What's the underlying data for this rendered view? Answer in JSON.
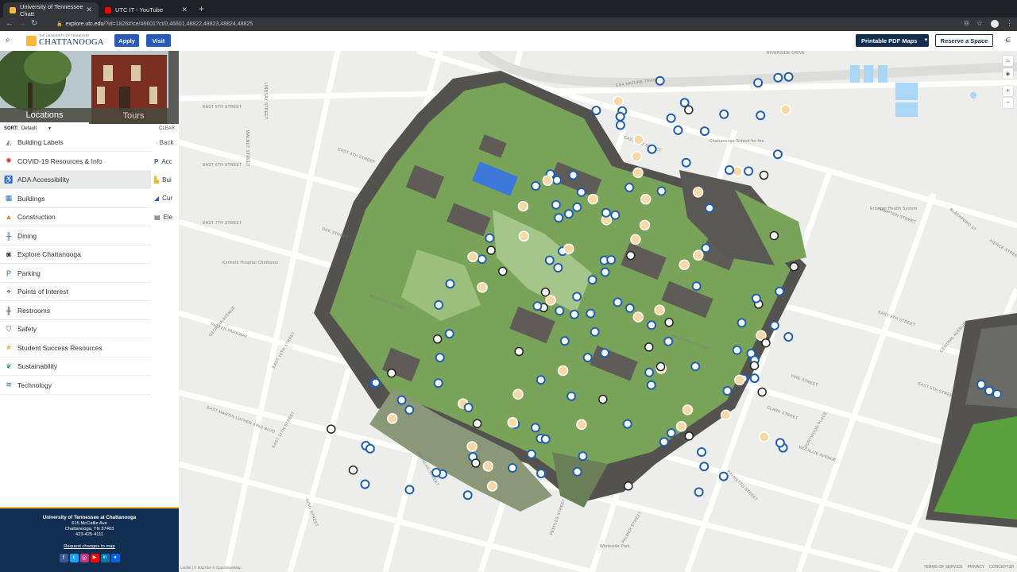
{
  "browser": {
    "tabs": [
      {
        "title": "University of Tennessee Chatt",
        "active": true,
        "favicon_color": "#fdb736"
      },
      {
        "title": "UTC IT - YouTube",
        "active": false,
        "favicon_color": "#ff0000"
      }
    ],
    "new_tab_icon": "plus-icon",
    "url_host": "explore.utc.edu",
    "url_path": "/?id=1826#!ce/46601?ct/0,46601,48822,48823,48824,48825"
  },
  "header": {
    "logo_top": "THE UNIVERSITY OF TENNESSEE",
    "logo_main": "CHATTANOOGA",
    "apply_label": "Apply",
    "visit_label": "Visit",
    "pdf_label": "Printable PDF Maps",
    "reserve_label": "Reserve a Space",
    "accent": "#112e51",
    "gold": "#fdb736"
  },
  "sidebar": {
    "tabs": {
      "locations": "Locations",
      "tours": "Tours"
    },
    "sort_label": "SORT:",
    "sort_value": "Default",
    "clear_label": "CLEAR",
    "categories": [
      {
        "label": "Building Labels",
        "icon": "label-icon",
        "color": "#888"
      },
      {
        "label": "COVID-19 Resources & Info",
        "icon": "virus-icon",
        "color": "#c0392b"
      },
      {
        "label": "ADA Accessibility",
        "icon": "wheelchair-icon",
        "color": "#2a6ebb"
      },
      {
        "label": "Buildings",
        "icon": "building-icon",
        "color": "#2a6ebb"
      },
      {
        "label": "Construction",
        "icon": "warning-icon",
        "color": "#e67e22"
      },
      {
        "label": "Dining",
        "icon": "utensils-icon",
        "color": "#2a6ebb"
      },
      {
        "label": "Explore Chattanooga",
        "icon": "camera-icon",
        "color": "#333"
      },
      {
        "label": "Parking",
        "icon": "parking-icon",
        "color": "#2a6ebb"
      },
      {
        "label": "Points of Interest",
        "icon": "pin-icon",
        "color": "#333"
      },
      {
        "label": "Restrooms",
        "icon": "restroom-icon",
        "color": "#333"
      },
      {
        "label": "Safety",
        "icon": "shield-icon",
        "color": "#2a6ebb"
      },
      {
        "label": "Student Success Resources",
        "icon": "star-icon",
        "color": "#e8b93b"
      },
      {
        "label": "Sustainability",
        "icon": "leaf-icon",
        "color": "#27ae60"
      },
      {
        "label": "Technology",
        "icon": "wifi-icon",
        "color": "#2a6ebb"
      }
    ],
    "subpanel": {
      "back_label": "Back",
      "items": [
        {
          "label": "Acc",
          "icon": "parking-icon"
        },
        {
          "label": "Bui",
          "icon": "building-icon"
        },
        {
          "label": "Cur",
          "icon": "curb-icon"
        },
        {
          "label": "Ele",
          "icon": "elevator-icon"
        }
      ]
    },
    "footer": {
      "name": "University of Tennessee at Chattanooga",
      "street": "615 McCallie Ave",
      "city": "Chattanooga, TN 37403",
      "phone": "423-425-4111",
      "request_link": "Request changes to map",
      "social": [
        "facebook-icon",
        "twitter-icon",
        "instagram-icon",
        "youtube-icon",
        "linkedin-icon",
        "flickr-icon"
      ]
    }
  },
  "map": {
    "street_labels": [
      "RIVERSIDE DRIVE",
      "CSX NATURE TRAIL",
      "EAST 3RD STREET",
      "EAST 4TH STREET",
      "EAST 5TH STREET",
      "EAST 6TH STREET",
      "EAST 7TH STREET",
      "EAST 8TH STREET",
      "EAST 9TH STREET",
      "EAST 10TH STREET",
      "EAST 11TH STREET",
      "OAK STREET",
      "VINE STREET",
      "CLARK STREET",
      "McCALLIE AVENUE",
      "PALMETTO STREET",
      "HOUSTON STREET",
      "CENTRAL AVENUE",
      "PATTEN PARKWAY",
      "GEORGIA AVENUE",
      "LINDSAY STREET",
      "WALNUT STREET",
      "DOUGLAS STREET",
      "KING STREET",
      "PEEPLES STREET",
      "FORTWOOD PLACE",
      "PALMER STREET",
      "EAST MARTIN LUTHER KING BLVD",
      "HAMPTON STREET",
      "BLACKFORD ST",
      "PIERCE STREET",
      "EAST 5TH STREET"
    ],
    "place_labels": [
      "Chattanooga School for the Arts and Sciences",
      "Erlanger Health System",
      "Kenneth Hospital Chattanooga",
      "Whiteside Park"
    ],
    "attribution": "Leaflet | © MapTiler © OpenStreetMap",
    "footer_links": [
      "TERMS OF SERVICE",
      "PRIVACY",
      "CONCEPT3D"
    ],
    "controls": [
      "home-icon",
      "layers-icon",
      "zoom-in-icon",
      "zoom-out-icon"
    ]
  }
}
